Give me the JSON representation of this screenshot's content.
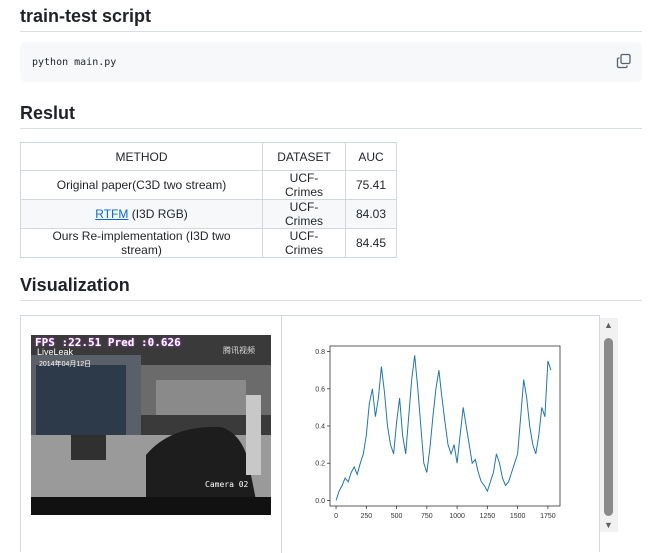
{
  "sections": {
    "train_test_title": "train-test script",
    "result_title": "Reslut",
    "visualization_title": "Visualization"
  },
  "code": {
    "command": "python main.py"
  },
  "results_table": {
    "headers": [
      "METHOD",
      "DATASET",
      "AUC"
    ],
    "rows": [
      {
        "method": "Original paper(C3D two stream)",
        "dataset": "UCF-Crimes",
        "auc": "75.41"
      },
      {
        "method_link": "RTFM",
        "method_suffix": " (I3D RGB)",
        "dataset": "UCF-Crimes",
        "auc": "84.03"
      },
      {
        "method": "Ours Re-implementation (I3D two stream)",
        "dataset": "UCF-Crimes",
        "auc": "84.45"
      }
    ]
  },
  "video_overlay": {
    "fps_text": "FPS :22.51  Pred :0.626",
    "date_text": "2014年04月12日",
    "camera_text": "Camera 02",
    "live_text": "LiveLeak",
    "watermark_text": "腾讯视频"
  },
  "chart_data": {
    "type": "line",
    "x_ticks": [
      "0",
      "250",
      "500",
      "750",
      "1000",
      "1250",
      "1500",
      "1750"
    ],
    "y_ticks": [
      "0.0",
      "0.2",
      "0.4",
      "0.6",
      "0.8"
    ],
    "xlim": [
      -50,
      1850
    ],
    "ylim": [
      -0.03,
      0.83
    ],
    "series_color": "#1f77b4",
    "series": [
      {
        "x": [
          0,
          25,
          50,
          75,
          100,
          125,
          150,
          175,
          200,
          225,
          250,
          275,
          300,
          325,
          350,
          375,
          400,
          425,
          450,
          475,
          500,
          525,
          550,
          575,
          600,
          625,
          650,
          675,
          700,
          725,
          750,
          775,
          800,
          825,
          850,
          875,
          900,
          925,
          950,
          975,
          1000,
          1025,
          1050,
          1075,
          1100,
          1125,
          1150,
          1175,
          1200,
          1225,
          1250,
          1275,
          1300,
          1325,
          1350,
          1375,
          1400,
          1425,
          1450,
          1475,
          1500,
          1525,
          1550,
          1575,
          1600,
          1625,
          1650,
          1675,
          1700,
          1725,
          1750,
          1775
        ],
        "y": [
          0.0,
          0.05,
          0.08,
          0.12,
          0.1,
          0.15,
          0.18,
          0.14,
          0.2,
          0.25,
          0.35,
          0.52,
          0.6,
          0.45,
          0.55,
          0.72,
          0.58,
          0.4,
          0.3,
          0.25,
          0.42,
          0.55,
          0.35,
          0.25,
          0.45,
          0.65,
          0.78,
          0.6,
          0.4,
          0.2,
          0.15,
          0.28,
          0.45,
          0.6,
          0.7,
          0.55,
          0.42,
          0.3,
          0.25,
          0.3,
          0.2,
          0.35,
          0.5,
          0.4,
          0.3,
          0.2,
          0.22,
          0.15,
          0.1,
          0.08,
          0.05,
          0.1,
          0.15,
          0.25,
          0.2,
          0.12,
          0.08,
          0.1,
          0.15,
          0.2,
          0.25,
          0.45,
          0.65,
          0.55,
          0.4,
          0.3,
          0.25,
          0.35,
          0.5,
          0.45,
          0.75,
          0.7
        ]
      }
    ]
  }
}
